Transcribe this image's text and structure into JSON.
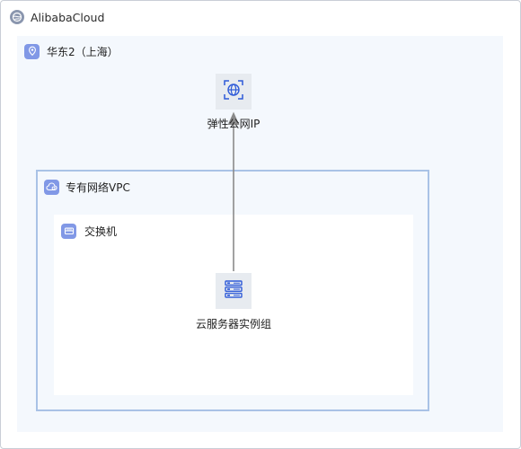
{
  "cloud": {
    "label": "AlibabaCloud"
  },
  "region": {
    "label": "华东2（上海）"
  },
  "vpc": {
    "label": "专有网络VPC"
  },
  "vswitch": {
    "label": "交换机"
  },
  "nodes": {
    "eip": {
      "label": "弹性公网IP",
      "icon": "globe-icon"
    },
    "ecs_group": {
      "label": "云服务器实例组",
      "icon": "server-group-icon"
    }
  },
  "edges": [
    {
      "from": "ecs_group",
      "to": "eip"
    }
  ],
  "colors": {
    "accent": "#8198e6",
    "icon_blue": "#2f5bd8",
    "vpc_border": "#a9c2e6",
    "edge": "#8a8a8a"
  }
}
